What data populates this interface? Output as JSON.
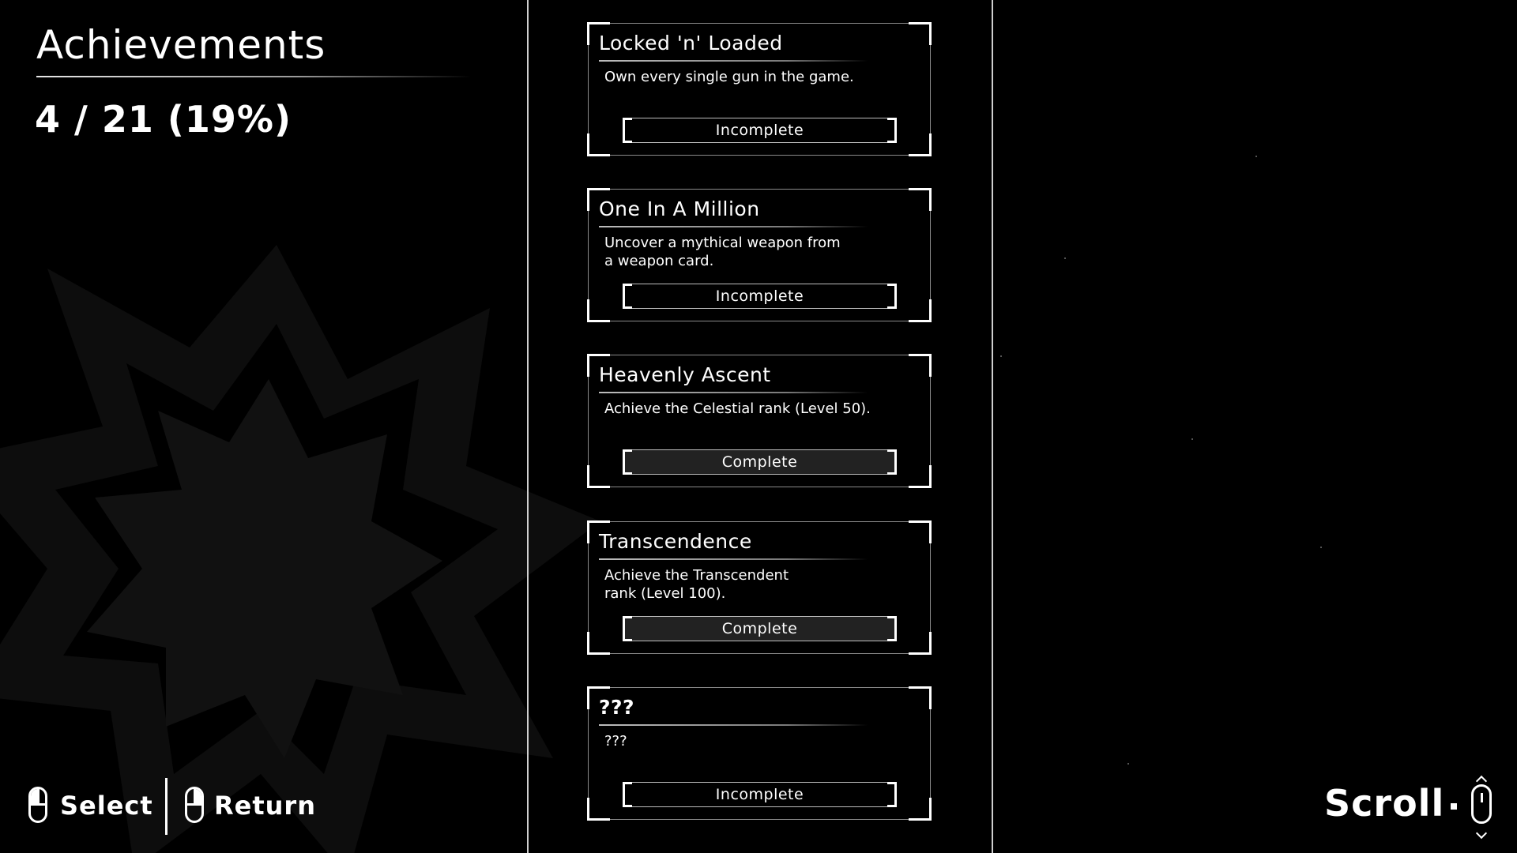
{
  "header": {
    "title": "Achievements",
    "progress": "4 / 21 (19%)",
    "unlocked": 4,
    "total": 21,
    "percent": 19
  },
  "controls": {
    "select_label": "Select",
    "return_label": "Return",
    "scroll_label": "Scroll"
  },
  "achievements": [
    {
      "title": "Locked 'n' Loaded",
      "description": "Own every single gun in the game.",
      "status": "Incomplete"
    },
    {
      "title": "One In A Million",
      "description": "Uncover a mythical weapon from\na weapon card.",
      "status": "Incomplete"
    },
    {
      "title": "Heavenly Ascent",
      "description": "Achieve the Celestial rank (Level 50).",
      "status": "Complete"
    },
    {
      "title": "Transcendence",
      "description": "Achieve the Transcendent\nrank (Level 100).",
      "status": "Complete"
    },
    {
      "title": "???",
      "description": "???",
      "status": "Incomplete"
    }
  ],
  "colors": {
    "background": "#000000",
    "text": "#ffffff",
    "complete_fill": "#222222",
    "decor_star": "#0d0d0d"
  }
}
